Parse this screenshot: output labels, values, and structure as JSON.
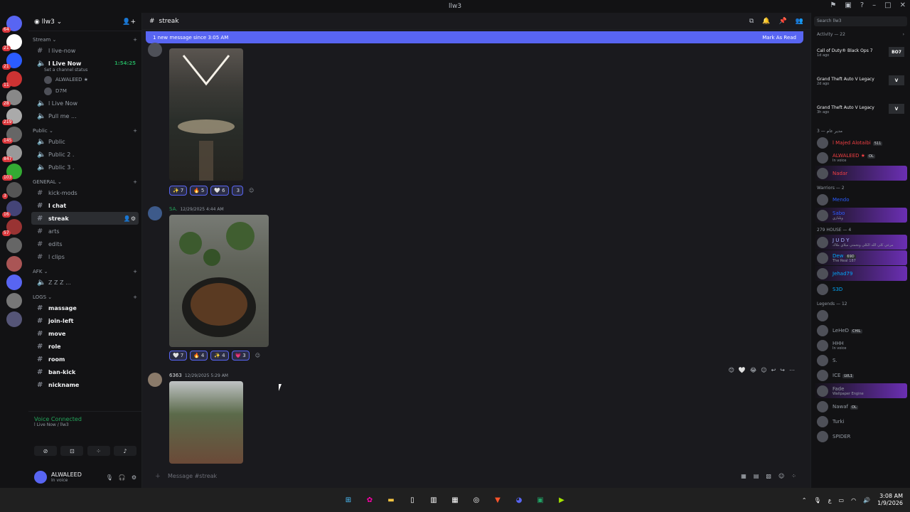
{
  "window": {
    "title": "llw3"
  },
  "servers": {
    "badges": [
      "64",
      "21",
      "21",
      "11",
      "28",
      "219",
      "145",
      "847",
      "103",
      "3",
      "16",
      "57"
    ]
  },
  "guild": {
    "name": "llw3"
  },
  "sections": {
    "stream": "Stream",
    "public": "Public",
    "general": "GENERAL",
    "afk": "AFK",
    "logs": "LOGS"
  },
  "channels": {
    "stream": [
      {
        "name": "l live-now",
        "type": "text"
      },
      {
        "name": "l Live Now",
        "type": "voice",
        "time": "1:54:25",
        "status": "Set a channel status",
        "users": [
          "ALWALEED ★",
          "D7M"
        ]
      },
      {
        "name": "l Live Now",
        "type": "voice"
      },
      {
        "name": "Pull me ...",
        "type": "voice"
      }
    ],
    "public": [
      "Public",
      "Public 2 .",
      "Public 3 ."
    ],
    "general": [
      "kick-mods",
      "l chat",
      "streak",
      "arts",
      "edits",
      "l clips"
    ],
    "afk": [
      "Z Z Z ..."
    ],
    "logs": [
      "massage",
      "join-left",
      "move",
      "role",
      "room",
      "ban-kick",
      "nickname"
    ]
  },
  "voice_panel": {
    "title": "Voice Connected",
    "sub": "l Live Now / llw3"
  },
  "user": {
    "name": "ALWALEED",
    "status": "In voice"
  },
  "main": {
    "channel": "streak",
    "new_bar": "1 new message since 3:05 AM",
    "mark_read": "Mark As Read",
    "composer_placeholder": "Message #streak"
  },
  "messages": [
    {
      "reactions": [
        {
          "e": "✨",
          "c": "7"
        },
        {
          "e": "🔥",
          "c": "5"
        },
        {
          "e": "🤍",
          "c": "6"
        },
        {
          "e": "",
          "c": "3"
        }
      ]
    },
    {
      "author": "SA.",
      "time": "12/29/2025 4:44 AM",
      "reactions": [
        {
          "e": "🤍",
          "c": "7"
        },
        {
          "e": "🔥",
          "c": "4"
        },
        {
          "e": "✨",
          "c": "4"
        },
        {
          "e": "💗",
          "c": "3"
        }
      ]
    },
    {
      "author": "6363",
      "time": "12/29/2025 5:29 AM"
    }
  ],
  "right": {
    "search": "Search llw3",
    "activity_title": "Activity — 22",
    "activities": [
      {
        "game": "Call of Duty® Black Ops 7",
        "ago": "1d ago",
        "icon": "BO7"
      },
      {
        "game": "Grand Theft Auto V Legacy",
        "ago": "2d ago",
        "icon": "V"
      },
      {
        "game": "Grand Theft Auto V Legacy",
        "ago": "3h ago",
        "icon": "V"
      }
    ],
    "groups": [
      {
        "title": "مدير عام — 3",
        "members": [
          {
            "name": "l Majed Alotaibi",
            "color": "#f23f43",
            "tag": "511"
          },
          {
            "name": "ALWALEED ★",
            "color": "#f23f43",
            "tag": "OL",
            "status": "In voice"
          },
          {
            "name": "Nadar",
            "color": "#f23f43",
            "hl": true
          }
        ]
      },
      {
        "title": "Warriors — 2",
        "members": [
          {
            "name": "Mendo",
            "color": "#2b5cff"
          },
          {
            "name": "Sabo",
            "color": "#2b5cff",
            "status": "ويلبازي",
            "hl": true
          }
        ]
      },
      {
        "title": "279 HOUSE — 4",
        "members": [
          {
            "name": "J U D Y",
            "color": "#a5b4ff",
            "status": "مرعي كلي الله الكلي ونجمتي ميلاي ملاك",
            "hl": true
          },
          {
            "name": "Dew",
            "color": "#00a8fc",
            "tag": "69D",
            "status": "The Real 187",
            "hl": true
          },
          {
            "name": "Jehad79",
            "color": "#00a8fc",
            "hl": true
          },
          {
            "name": "S3D",
            "color": "#00a8fc"
          }
        ]
      },
      {
        "title": "Legends — 12",
        "members": [
          {
            "name": "",
            "color": "#949ba4"
          },
          {
            "name": "LeHeD",
            "color": "#949ba4",
            "tag": "CHIL"
          },
          {
            "name": "HHH",
            "color": "#949ba4",
            "status": "In voice"
          },
          {
            "name": "S.",
            "color": "#949ba4"
          },
          {
            "name": "ICE",
            "color": "#949ba4",
            "tag": "LVL1"
          },
          {
            "name": "Fade",
            "color": "#949ba4",
            "status": "Wallpaper Engine",
            "hl": true
          },
          {
            "name": "Nawaf",
            "color": "#949ba4",
            "tag": "OL"
          },
          {
            "name": "Turki",
            "color": "#949ba4"
          },
          {
            "name": "SPIDER",
            "color": "#949ba4"
          }
        ]
      }
    ]
  },
  "taskbar": {
    "time": "3:08 AM",
    "date": "1/9/2026",
    "lang": "ع"
  },
  "colors": {
    "accent": "#5865f2",
    "online": "#23a55a",
    "bg": "#1a1a1e"
  }
}
